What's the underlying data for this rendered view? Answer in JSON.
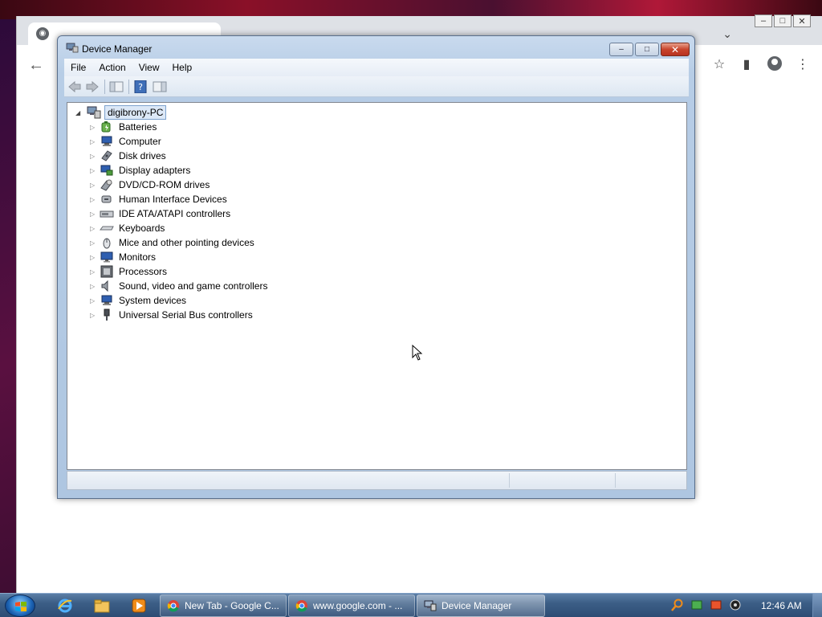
{
  "window": {
    "title": "Device Manager",
    "controls": {
      "minimize": "–",
      "maximize": "□",
      "close": "✕"
    }
  },
  "menu": [
    "File",
    "Action",
    "View",
    "Help"
  ],
  "tree": {
    "root": "digibrony-PC",
    "items": [
      {
        "label": "Batteries",
        "icon": "battery-icon"
      },
      {
        "label": "Computer",
        "icon": "computer-icon"
      },
      {
        "label": "Disk drives",
        "icon": "disk-drive-icon"
      },
      {
        "label": "Display adapters",
        "icon": "display-adapter-icon"
      },
      {
        "label": "DVD/CD-ROM drives",
        "icon": "dvd-drive-icon"
      },
      {
        "label": "Human Interface Devices",
        "icon": "hid-icon"
      },
      {
        "label": "IDE ATA/ATAPI controllers",
        "icon": "ide-controller-icon"
      },
      {
        "label": "Keyboards",
        "icon": "keyboard-icon"
      },
      {
        "label": "Mice and other pointing devices",
        "icon": "mouse-icon"
      },
      {
        "label": "Monitors",
        "icon": "monitor-icon"
      },
      {
        "label": "Processors",
        "icon": "processor-icon"
      },
      {
        "label": "Sound, video and game controllers",
        "icon": "sound-icon"
      },
      {
        "label": "System devices",
        "icon": "system-devices-icon"
      },
      {
        "label": "Universal Serial Bus controllers",
        "icon": "usb-icon"
      }
    ]
  },
  "taskbar": {
    "tasks": [
      {
        "label": "New Tab - Google C...",
        "icon": "chrome-icon"
      },
      {
        "label": "www.google.com - ...",
        "icon": "chrome-icon"
      },
      {
        "label": "Device Manager",
        "icon": "device-manager-icon"
      }
    ],
    "clock": "12:46 AM"
  }
}
